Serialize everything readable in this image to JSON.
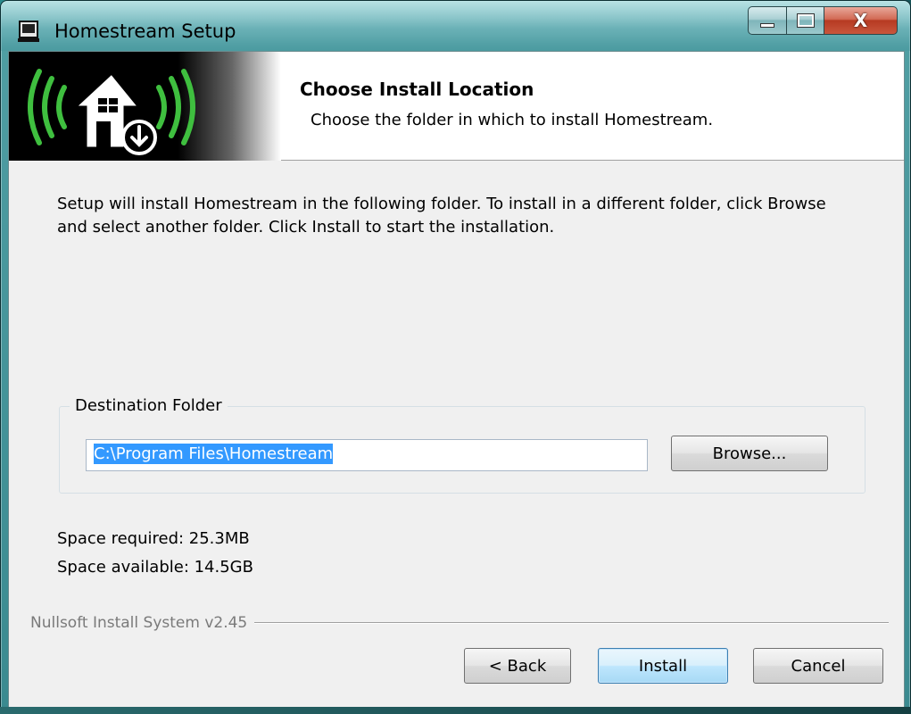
{
  "window": {
    "title": "Homestream Setup",
    "close_glyph": "X"
  },
  "header": {
    "title": "Choose Install Location",
    "subtitle": "Choose the folder in which to install Homestream."
  },
  "intro_text": "Setup will install Homestream in the following folder. To install in a different folder, click Browse and select another folder. Click Install to start the installation.",
  "destination": {
    "legend": "Destination Folder",
    "path": "C:\\Program Files\\Homestream",
    "browse_label": "Browse..."
  },
  "space": {
    "required": "Space required: 25.3MB",
    "available": "Space available: 14.5GB"
  },
  "footer": {
    "branding": "Nullsoft Install System v2.45"
  },
  "buttons": {
    "back": "< Back",
    "install": "Install",
    "cancel": "Cancel"
  },
  "colors": {
    "selection": "#3399ff",
    "banner_green": "#3fbf3f",
    "default_button_border": "#3c7fb1"
  },
  "icons": [
    "installer-app-icon",
    "minimize-icon",
    "maximize-icon",
    "close-icon",
    "homestream-logo"
  ]
}
